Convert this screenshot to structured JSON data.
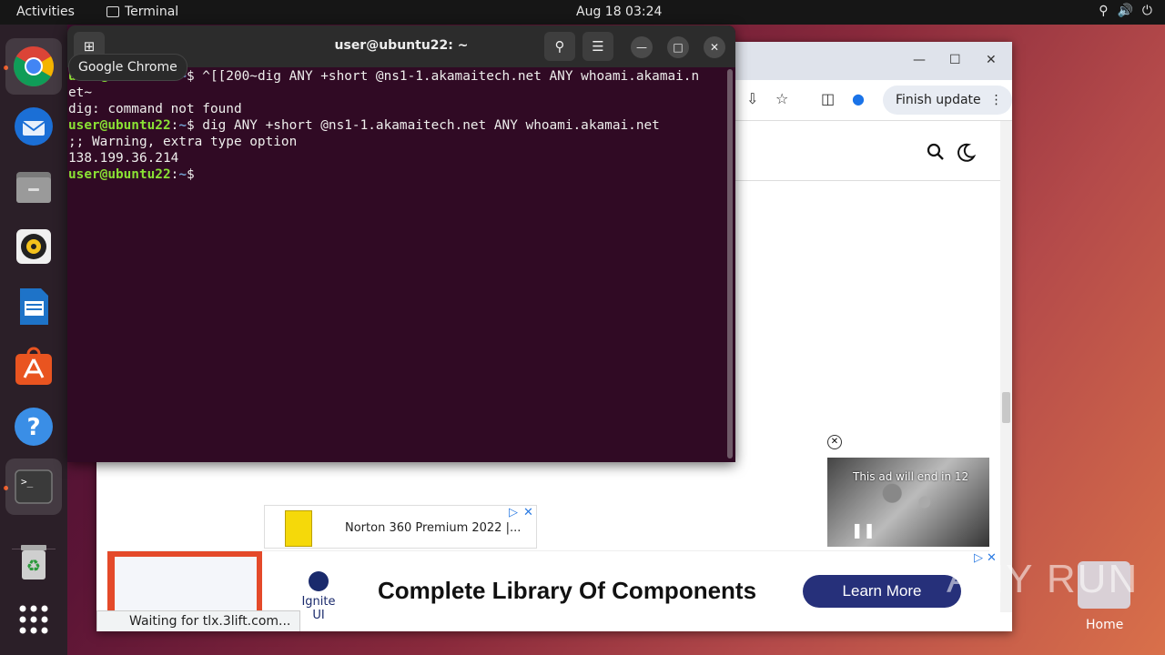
{
  "topbar": {
    "activities": "Activities",
    "app_name": "Terminal",
    "clock": "Aug 18  03:24",
    "sys_icons": [
      "network-icon",
      "volume-icon",
      "power-icon"
    ]
  },
  "dock": {
    "tooltip": "Google Chrome",
    "items": [
      "chrome",
      "thunderbird",
      "files",
      "rhythmbox",
      "writer",
      "software",
      "help",
      "terminal",
      "trash",
      "app-grid"
    ]
  },
  "chrome": {
    "finish_update": "Finish update",
    "norton_ad": "Norton 360 Premium 2022 |...",
    "video_ad_caption": "This ad will end in 12",
    "banner_brand": "Ignite UI",
    "banner_headline": "Complete Library Of Components",
    "banner_button": "Learn More",
    "status_text": "Waiting for tlx.3lift.com..."
  },
  "terminal": {
    "title": "user@ubuntu22: ~",
    "prompt_user": "user@ubuntu22",
    "prompt_path": "~",
    "line1_cmd": "$ ^[[200~dig ANY +short @ns1-1.akamaitech.net ANY whoami.akamai.n",
    "line1_wrap": "et~",
    "line2": "dig: command not found",
    "line3_cmd": "$ dig ANY +short @ns1-1.akamaitech.net ANY whoami.akamai.net",
    "line4": ";; Warning, extra type option",
    "line5": "138.199.36.214",
    "line6_cmd": "$"
  },
  "watermark": "ANY RUN",
  "desktop": {
    "home_label": "Home"
  },
  "colors": {
    "terminal_bg": "#300a24",
    "prompt_user": "#8ae234",
    "prompt_path": "#729fcf",
    "ubuntu_orange": "#e95420"
  }
}
